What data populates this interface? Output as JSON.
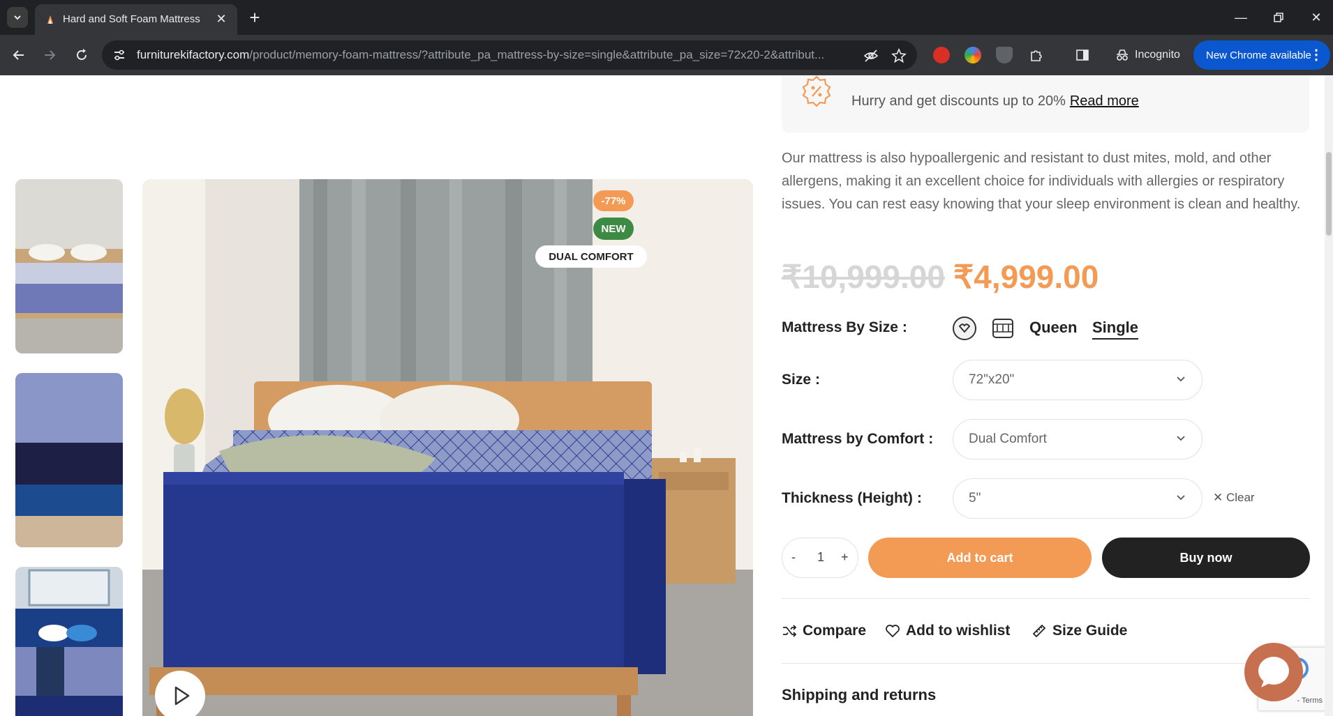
{
  "browser": {
    "tab_title": "Hard and Soft Foam Mattress -",
    "url_host": "furniturekifactory.com",
    "url_path": "/product/memory-foam-mattress/?attribute_pa_mattress-by-size=single&attribute_pa_size=72x20-2&attribut...",
    "incognito_label": "Incognito",
    "update_label": "New Chrome available"
  },
  "promo": {
    "text": "Hurry and get discounts up to 20%",
    "link": "Read more"
  },
  "description": "Our mattress is also hypoallergenic and resistant to dust mites, mold, and other allergens, making it an excellent choice for individuals with allergies or respiratory issues. You can rest easy knowing that your sleep environment is clean and healthy.",
  "price": {
    "old": "₹10,999.00",
    "new": "₹4,999.00"
  },
  "badges": {
    "discount": "-77%",
    "new": "NEW",
    "comfort": "DUAL COMFORT"
  },
  "options": {
    "mattress_by_size_label": "Mattress By Size",
    "size_choices": [
      "Queen",
      "Single"
    ],
    "selected_size_choice": "Single",
    "size_label": "Size",
    "size_value": "72\"x20\"",
    "comfort_label": "Mattress by Comfort",
    "comfort_value": "Dual Comfort",
    "thickness_label": "Thickness (Height)",
    "thickness_value": "5\"",
    "clear_label": "Clear",
    "colon": ":"
  },
  "cart": {
    "minus": "-",
    "qty": "1",
    "plus": "+",
    "add_to_cart": "Add to cart",
    "buy_now": "Buy now"
  },
  "actions": {
    "compare": "Compare",
    "wishlist": "Add to wishlist",
    "size_guide": "Size Guide"
  },
  "shipping_heading": "Shipping and returns",
  "recaptcha_terms": "- Terms",
  "colors": {
    "accent": "#f39a55",
    "new_badge": "#3c8a44",
    "mattress_blue": "#263a8c"
  }
}
